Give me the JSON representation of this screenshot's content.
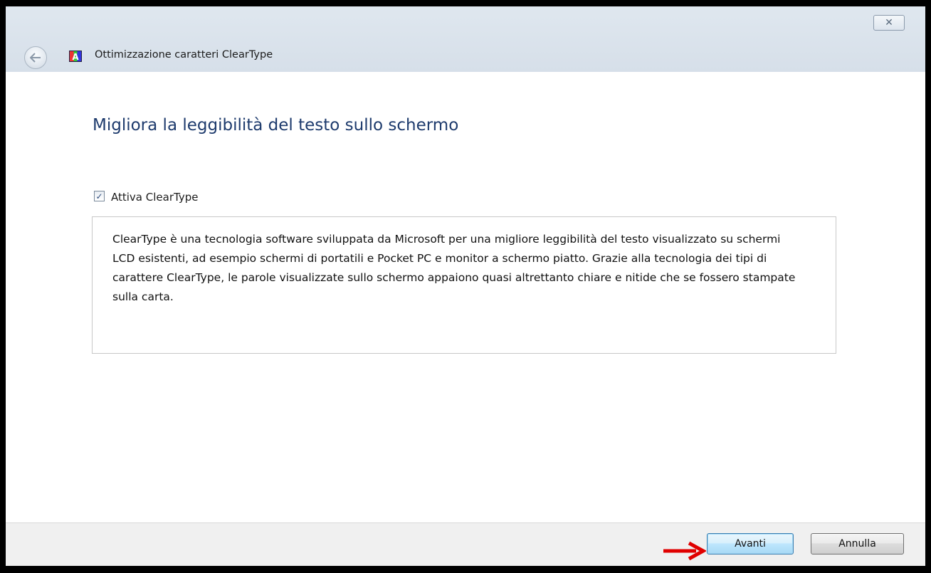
{
  "window": {
    "title": "Ottimizzazione caratteri ClearType",
    "app_icon_letter": "A",
    "close_glyph": "✕"
  },
  "content": {
    "heading": "Migliora la leggibilità del testo sullo schermo",
    "checkbox": {
      "label": "Attiva ClearType",
      "checked": true
    },
    "description": "ClearType è una tecnologia software sviluppata da Microsoft per una migliore leggibilità del testo visualizzato su schermi LCD esistenti, ad esempio schermi di portatili e Pocket PC e monitor a schermo piatto. Grazie alla tecnologia dei tipi di carattere ClearType, le parole visualizzate sullo schermo appaiono quasi altrettanto chiare e nitide che se fossero stampate sulla carta."
  },
  "footer": {
    "next_label": "Avanti",
    "cancel_label": "Annulla"
  },
  "annotation": {
    "color": "#e00000",
    "icon": "arrow-right-icon"
  },
  "colors": {
    "heading": "#1e3b6d",
    "accent_button": "#3c7fb1"
  }
}
